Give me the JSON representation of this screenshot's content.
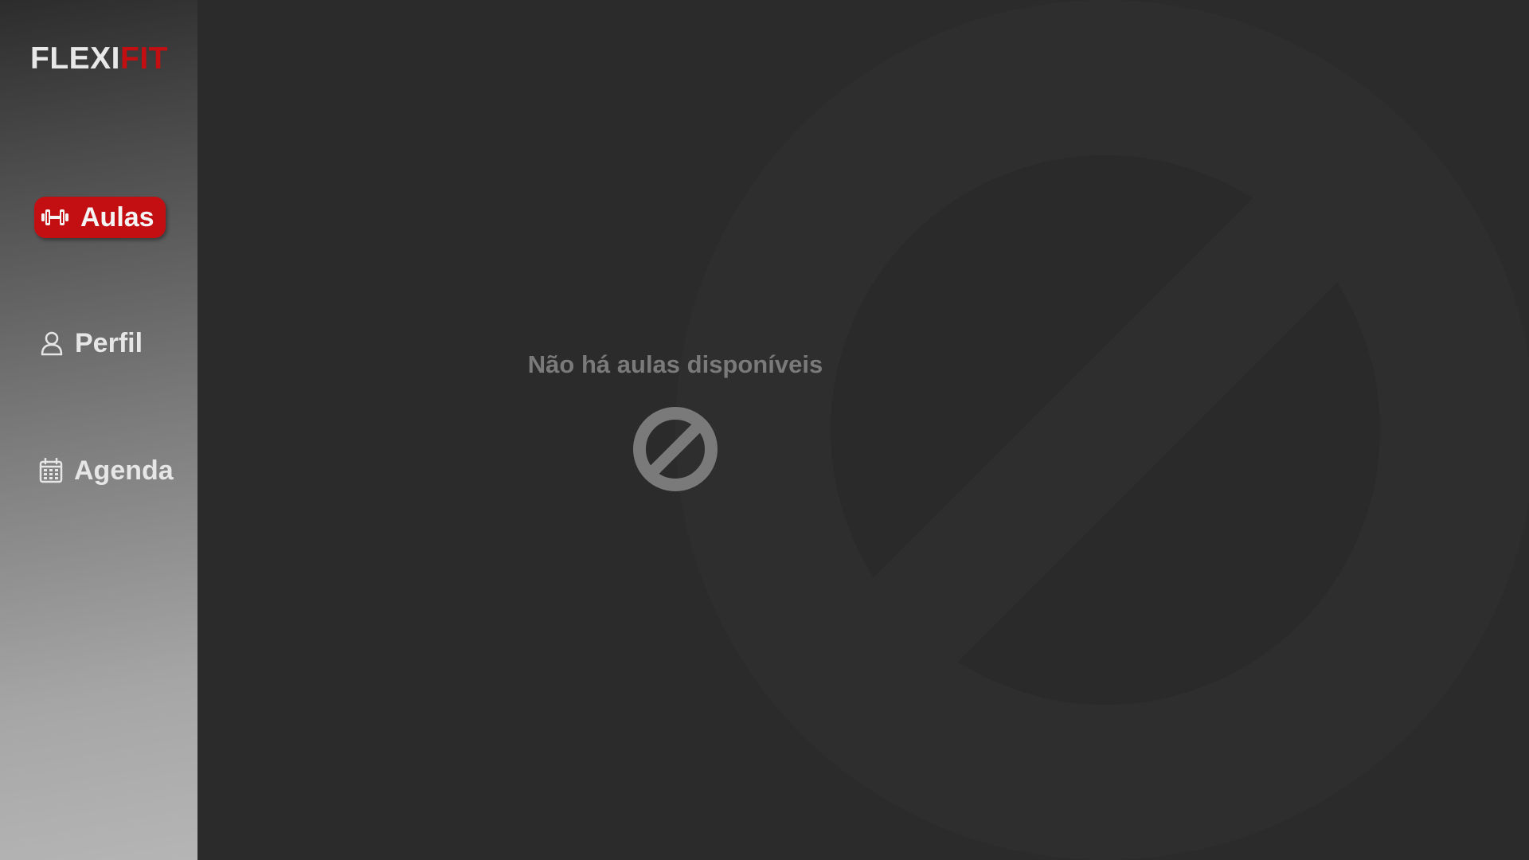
{
  "brand": {
    "name_part1": "FLEXI",
    "name_part2": "FIT",
    "accent_color": "#c30e12"
  },
  "sidebar": {
    "items": [
      {
        "label": "Aulas",
        "icon": "dumbbell-icon",
        "active": true
      },
      {
        "label": "Perfil",
        "icon": "user-icon",
        "active": false
      },
      {
        "label": "Agenda",
        "icon": "calendar-icon",
        "active": false
      }
    ]
  },
  "main": {
    "empty_message": "Não há aulas disponíveis",
    "empty_icon": "no-entry-icon",
    "background_icon": "no-entry-watermark-icon"
  },
  "colors": {
    "background": "#2b2b2b",
    "text_muted": "#7a7a7a",
    "sidebar_text": "#e6e6e6"
  }
}
